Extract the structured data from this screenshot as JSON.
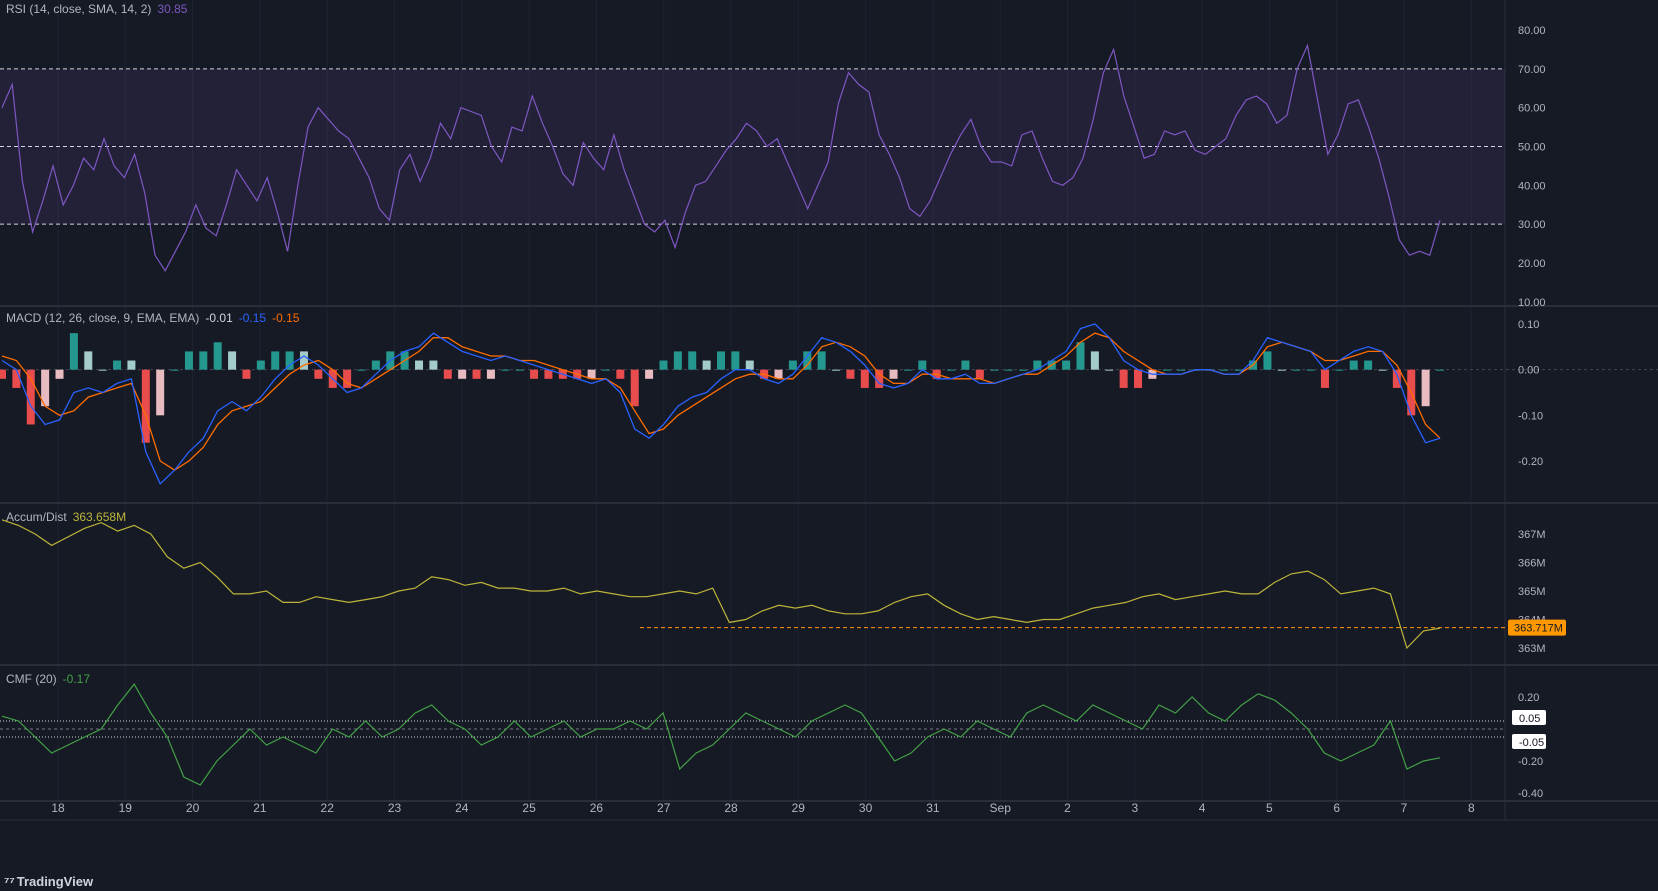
{
  "panes": {
    "rsi": {
      "label": "RSI (14, close, SMA, 14, 2)",
      "value": "30.85",
      "value_color": "#7e57c2"
    },
    "macd": {
      "label": "MACD (12, 26, close, 9, EMA, EMA)",
      "v1": "-0.01",
      "v2": "-0.15",
      "v3": "-0.15",
      "c1": "#d1d4dc",
      "c2": "#2962ff",
      "c3": "#ff6d00"
    },
    "ad": {
      "label": "Accum/Dist",
      "value": "363.658M",
      "value_color": "#bdb53a"
    },
    "cmf": {
      "label": "CMF (20)",
      "value": "-0.17",
      "value_color": "#43a047"
    }
  },
  "logo": "TradingView",
  "chart_data": [
    {
      "type": "line",
      "title": "RSI (14, close, SMA, 14, 2)",
      "y_ticks": [
        "80.00",
        "70.00",
        "60.00",
        "50.00",
        "40.00",
        "30.00",
        "20.00",
        "10.00"
      ],
      "ylim": [
        10,
        85
      ],
      "bands": [
        30,
        50,
        70
      ],
      "series": [
        {
          "color": "#7e57c2",
          "values": [
            60,
            66,
            41,
            28,
            36,
            45,
            35,
            40,
            47,
            44,
            52,
            45,
            42,
            48,
            38,
            22,
            18,
            23,
            28,
            35,
            29,
            27,
            35,
            44,
            40,
            36,
            42,
            33,
            23,
            40,
            55,
            60,
            57,
            54,
            52,
            47,
            42,
            34,
            31,
            44,
            48,
            41,
            47,
            56,
            52,
            60,
            59,
            58,
            50,
            46,
            55,
            54,
            63,
            56,
            50,
            43,
            40,
            51,
            47,
            44,
            53,
            44,
            37,
            30,
            28,
            31,
            24,
            33,
            40,
            41,
            45,
            49,
            52,
            56,
            54,
            50,
            52,
            46,
            40,
            34,
            40,
            46,
            61,
            69,
            66,
            64,
            53,
            48,
            42,
            34,
            32,
            36,
            42,
            48,
            53,
            57,
            50,
            46,
            46,
            45,
            53,
            54,
            47,
            41,
            40,
            42,
            47,
            57,
            69,
            75,
            63,
            55,
            47,
            48,
            54,
            53,
            54,
            49,
            48,
            50,
            52,
            58,
            62,
            63,
            61,
            56,
            58,
            70,
            76,
            62,
            48,
            53,
            61,
            62,
            55,
            47,
            37,
            26,
            22,
            23,
            22,
            31
          ]
        }
      ]
    },
    {
      "type": "line",
      "title": "MACD (12, 26, close, 9, EMA, EMA)",
      "y_ticks": [
        "0.10",
        "0.00",
        "-0.10",
        "-0.20"
      ],
      "ylim": [
        -0.25,
        0.12
      ],
      "series": [
        {
          "name": "MACD",
          "color": "#2962ff",
          "values": [
            0.02,
            0.0,
            -0.08,
            -0.12,
            -0.11,
            -0.05,
            -0.04,
            -0.05,
            -0.03,
            -0.02,
            -0.18,
            -0.25,
            -0.22,
            -0.18,
            -0.15,
            -0.09,
            -0.07,
            -0.09,
            -0.06,
            -0.02,
            0.01,
            0.03,
            0.01,
            -0.02,
            -0.05,
            -0.04,
            -0.01,
            0.02,
            0.04,
            0.05,
            0.08,
            0.06,
            0.04,
            0.03,
            0.02,
            0.03,
            0.02,
            0.01,
            0.0,
            -0.01,
            -0.02,
            -0.03,
            -0.02,
            -0.05,
            -0.13,
            -0.15,
            -0.12,
            -0.08,
            -0.06,
            -0.05,
            -0.02,
            0.0,
            0.0,
            -0.02,
            -0.03,
            -0.01,
            0.03,
            0.07,
            0.06,
            0.04,
            0.01,
            -0.03,
            -0.04,
            -0.03,
            0.0,
            -0.02,
            -0.02,
            -0.01,
            -0.03,
            -0.03,
            -0.02,
            -0.01,
            0.0,
            0.02,
            0.04,
            0.09,
            0.1,
            0.07,
            0.02,
            0.0,
            -0.01,
            -0.01,
            -0.01,
            0.0,
            0.0,
            -0.01,
            -0.01,
            0.02,
            0.07,
            0.06,
            0.05,
            0.04,
            0.0,
            0.02,
            0.04,
            0.05,
            0.04,
            -0.01,
            -0.1,
            -0.16,
            -0.15
          ]
        },
        {
          "name": "Signal",
          "color": "#ff6d00",
          "values": [
            0.03,
            0.02,
            -0.02,
            -0.08,
            -0.1,
            -0.09,
            -0.06,
            -0.05,
            -0.04,
            -0.03,
            -0.1,
            -0.2,
            -0.22,
            -0.2,
            -0.17,
            -0.12,
            -0.09,
            -0.08,
            -0.07,
            -0.04,
            -0.01,
            0.01,
            0.02,
            0.0,
            -0.03,
            -0.04,
            -0.02,
            0.0,
            0.02,
            0.04,
            0.07,
            0.07,
            0.05,
            0.04,
            0.03,
            0.03,
            0.02,
            0.02,
            0.01,
            0.0,
            -0.01,
            -0.02,
            -0.02,
            -0.04,
            -0.09,
            -0.14,
            -0.13,
            -0.1,
            -0.08,
            -0.06,
            -0.04,
            -0.02,
            -0.01,
            -0.01,
            -0.02,
            -0.02,
            0.01,
            0.05,
            0.06,
            0.05,
            0.03,
            -0.01,
            -0.03,
            -0.03,
            -0.01,
            -0.01,
            -0.02,
            -0.02,
            -0.02,
            -0.03,
            -0.02,
            -0.01,
            -0.01,
            0.01,
            0.03,
            0.06,
            0.08,
            0.07,
            0.04,
            0.02,
            0.0,
            -0.01,
            -0.01,
            0.0,
            0.0,
            -0.01,
            -0.01,
            0.01,
            0.05,
            0.06,
            0.05,
            0.04,
            0.02,
            0.02,
            0.03,
            0.04,
            0.04,
            0.01,
            -0.05,
            -0.12,
            -0.15
          ]
        }
      ]
    },
    {
      "type": "line",
      "title": "Accum/Dist",
      "y_ticks": [
        "368M",
        "367M",
        "366M",
        "365M",
        "364M",
        "363M"
      ],
      "ylim": [
        362.6,
        368.1
      ],
      "price_line": "363.717M",
      "series": [
        {
          "color": "#bdb53a",
          "values": [
            367.5,
            367.3,
            367.0,
            366.6,
            366.9,
            367.2,
            367.4,
            367.1,
            367.3,
            367.0,
            366.2,
            365.8,
            366.0,
            365.5,
            364.9,
            364.9,
            365.0,
            364.6,
            364.6,
            364.8,
            364.7,
            364.6,
            364.7,
            364.8,
            365.0,
            365.1,
            365.5,
            365.4,
            365.2,
            365.3,
            365.1,
            365.1,
            365.0,
            365.0,
            365.1,
            364.9,
            365.0,
            364.9,
            364.8,
            364.8,
            364.9,
            365.0,
            364.9,
            365.1,
            363.9,
            364.0,
            364.3,
            364.5,
            364.4,
            364.5,
            364.3,
            364.2,
            364.2,
            364.3,
            364.6,
            364.8,
            364.9,
            364.5,
            364.2,
            364.0,
            364.1,
            364.0,
            363.9,
            364.0,
            364.0,
            364.2,
            364.4,
            364.5,
            364.6,
            364.8,
            364.9,
            364.7,
            364.8,
            364.9,
            365.0,
            364.9,
            364.9,
            365.3,
            365.6,
            365.7,
            365.4,
            364.9,
            365.0,
            365.1,
            364.9,
            363.0,
            363.6,
            363.7
          ]
        }
      ]
    },
    {
      "type": "line",
      "title": "CMF (20)",
      "y_ticks": [
        "0.20",
        "-0.20",
        "-0.40"
      ],
      "ylim": [
        -0.43,
        0.3
      ],
      "bands": [
        0.05,
        -0.05
      ],
      "series": [
        {
          "color": "#43a047",
          "values": [
            0.08,
            0.05,
            -0.05,
            -0.15,
            -0.1,
            -0.05,
            0.0,
            0.15,
            0.28,
            0.1,
            -0.05,
            -0.3,
            -0.35,
            -0.2,
            -0.1,
            0.0,
            -0.1,
            -0.05,
            -0.1,
            -0.15,
            0.0,
            -0.05,
            0.05,
            -0.05,
            0.0,
            0.1,
            0.15,
            0.05,
            0.0,
            -0.1,
            -0.05,
            0.05,
            -0.05,
            0.0,
            0.05,
            -0.05,
            0.0,
            0.0,
            0.05,
            0.0,
            0.1,
            -0.25,
            -0.15,
            -0.1,
            0.0,
            0.1,
            0.05,
            0.0,
            -0.05,
            0.05,
            0.1,
            0.15,
            0.1,
            -0.05,
            -0.2,
            -0.15,
            -0.05,
            0.0,
            -0.05,
            0.05,
            0.0,
            -0.05,
            0.1,
            0.15,
            0.1,
            0.05,
            0.15,
            0.1,
            0.05,
            0.0,
            0.15,
            0.1,
            0.2,
            0.1,
            0.05,
            0.15,
            0.22,
            0.18,
            0.1,
            0.0,
            -0.15,
            -0.2,
            -0.15,
            -0.1,
            0.05,
            -0.25,
            -0.2,
            -0.18
          ]
        }
      ]
    }
  ],
  "x_ticks": [
    "18",
    "19",
    "20",
    "21",
    "22",
    "23",
    "24",
    "25",
    "26",
    "27",
    "28",
    "29",
    "30",
    "31",
    "Sep",
    "2",
    "3",
    "4",
    "5",
    "6",
    "7",
    "8"
  ],
  "labels": {
    "cmf_upper": "0.05",
    "cmf_lower": "-0.05"
  }
}
